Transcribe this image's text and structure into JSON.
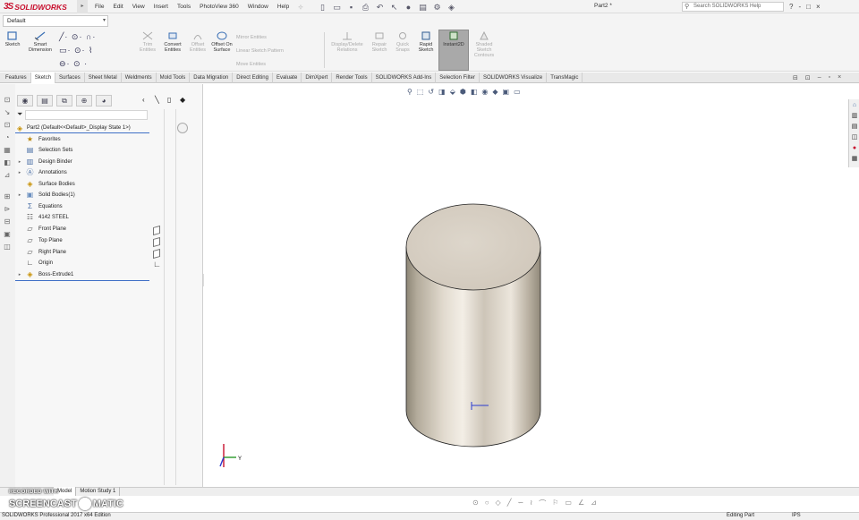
{
  "app": {
    "brand_prefix": "3S",
    "brand": "SOLIDWORKS",
    "menu": [
      "File",
      "Edit",
      "View",
      "Insert",
      "Tools",
      "PhotoView 360",
      "Window",
      "Help"
    ],
    "doc_name": "Part2 *",
    "help_search_placeholder": "Search SOLIDWORKS Help",
    "help_buttons": [
      "?",
      "-",
      "□",
      "×"
    ]
  },
  "config_selector": {
    "value": "Default"
  },
  "ribbon": {
    "sketch": "Sketch",
    "smart_dimension": "Smart Dimension",
    "trim_entities": "Trim Entities",
    "convert_entities": "Convert Entities",
    "offset_entities": "Offset Entities",
    "offset_on_surface": "Offset On Surface",
    "mirror_entities": "Mirror Entities",
    "linear_sketch_pattern": "Linear Sketch Pattern",
    "move_entities": "Move Entities",
    "display_delete_relations": "Display/Delete Relations",
    "repair_sketch": "Repair Sketch",
    "quick_snaps": "Quick Snaps",
    "rapid_sketch": "Rapid Sketch",
    "instant2d": "Instant2D",
    "shaded_sketch_contours": "Shaded Sketch Contours"
  },
  "tabs": [
    "Features",
    "Sketch",
    "Surfaces",
    "Sheet Metal",
    "Weldments",
    "Mold Tools",
    "Data Migration",
    "Direct Editing",
    "Evaluate",
    "DimXpert",
    "Render Tools",
    "SOLIDWORKS Add-Ins",
    "Selection Filter",
    "SOLIDWORKS Visualize",
    "TransMagic"
  ],
  "tree": {
    "root": "Part2  (Default<<Default>_Display State 1>)",
    "items": [
      {
        "label": "Favorites",
        "icon": "star-icon",
        "expandable": false
      },
      {
        "label": "Selection Sets",
        "icon": "selection-sets-icon",
        "expandable": false
      },
      {
        "label": "Design Binder",
        "icon": "binder-icon",
        "expandable": true
      },
      {
        "label": "Annotations",
        "icon": "annotations-icon",
        "expandable": true
      },
      {
        "label": "Surface Bodies",
        "icon": "surface-bodies-icon",
        "expandable": false
      },
      {
        "label": "Solid Bodies(1)",
        "icon": "solid-bodies-icon",
        "expandable": true
      },
      {
        "label": "Equations",
        "icon": "equations-icon",
        "expandable": false
      },
      {
        "label": "4142 STEEL",
        "icon": "material-icon",
        "expandable": false
      },
      {
        "label": "Front Plane",
        "icon": "plane-icon",
        "expandable": false
      },
      {
        "label": "Top Plane",
        "icon": "plane-icon",
        "expandable": false
      },
      {
        "label": "Right Plane",
        "icon": "plane-icon",
        "expandable": false
      },
      {
        "label": "Origin",
        "icon": "origin-icon",
        "expandable": false
      },
      {
        "label": "Boss-Extrude1",
        "icon": "extrude-icon",
        "expandable": true
      }
    ]
  },
  "triad": {
    "y_label": "Y"
  },
  "bottom_tabs": [
    "Model",
    "Motion Study 1"
  ],
  "status": {
    "left": "SOLIDWORKS Professional 2017 x64 Edition",
    "mode": "Editing Part",
    "units": "IPS"
  },
  "watermark": {
    "top": "RECORDED WITH",
    "main_a": "SCREENCAST",
    "main_b": "MATIC"
  },
  "colors": {
    "accent": "#c8102e",
    "tree_blue": "#3f6fc6",
    "tab_blue": "#4b6a8f",
    "model_top": "#d7cfc4"
  }
}
